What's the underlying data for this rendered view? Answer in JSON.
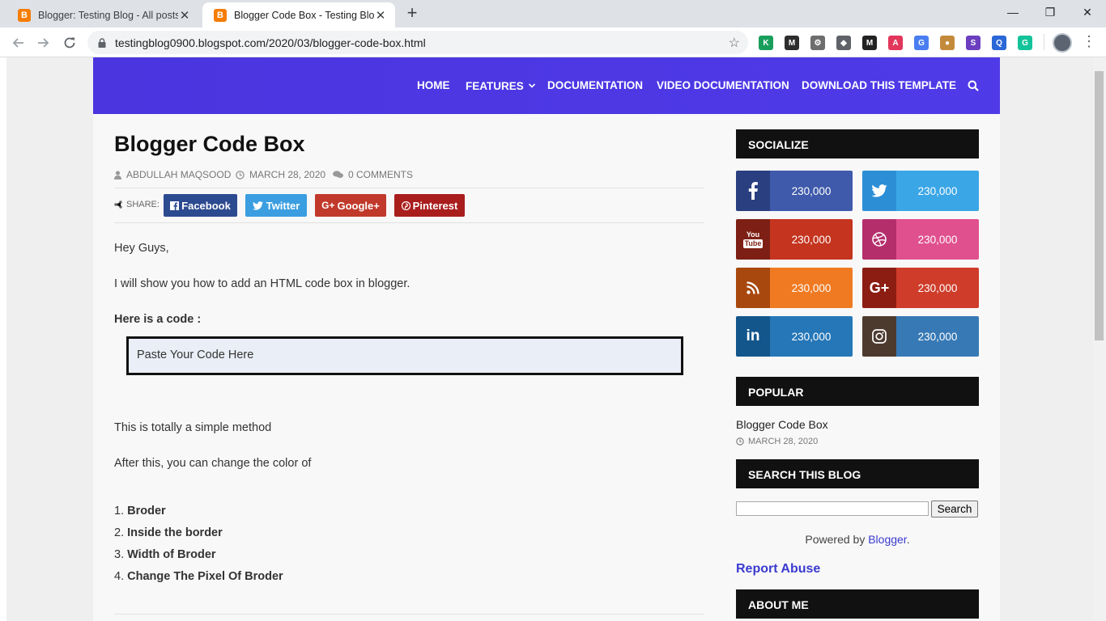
{
  "browser": {
    "tabs": [
      {
        "title": "Blogger: Testing Blog - All posts",
        "favicon": "B"
      },
      {
        "title": "Blogger Code Box - Testing Blog",
        "favicon": "B"
      }
    ],
    "new_tab_label": "+",
    "url": "testingblog0900.blogspot.com/2020/03/blogger-code-box.html",
    "extensions": [
      {
        "icon": "k-extension-icon",
        "label": "K",
        "color": "#1a9e5c"
      },
      {
        "icon": "m-extension-icon",
        "label": "M",
        "color": "#2d2d2d"
      },
      {
        "icon": "gear-extension-icon",
        "label": "⚙",
        "color": "#6d6d6d"
      },
      {
        "icon": "fox-extension-icon",
        "label": "◆",
        "color": "#5f6368"
      },
      {
        "icon": "medium-extension-icon",
        "label": "M",
        "color": "#222222"
      },
      {
        "icon": "a-extension-icon",
        "label": "A",
        "color": "#e2365b"
      },
      {
        "icon": "translate-extension-icon",
        "label": "G",
        "color": "#4a7ef0"
      },
      {
        "icon": "cookie-extension-icon",
        "label": "●",
        "color": "#c48a3c"
      },
      {
        "icon": "s-extension-icon",
        "label": "S",
        "color": "#6b3fbf"
      },
      {
        "icon": "q-extension-icon",
        "label": "Q",
        "color": "#2b67d6"
      },
      {
        "icon": "grammarly-extension-icon",
        "label": "G",
        "color": "#15c39a"
      }
    ]
  },
  "nav": {
    "items": [
      "HOME",
      "FEATURES",
      "DOCUMENTATION",
      "VIDEO DOCUMENTATION",
      "DOWNLOAD THIS TEMPLATE"
    ],
    "color": "#4e34e6"
  },
  "post": {
    "title": "Blogger Code Box",
    "author": "ABDULLAH MAQSOOD",
    "date": "MARCH 28, 2020",
    "comments": "0 COMMENTS",
    "share_label": "SHARE:",
    "share_buttons": [
      {
        "label": "Facebook",
        "color": "#2c4a8f"
      },
      {
        "label": "Twitter",
        "color": "#3a9ee0"
      },
      {
        "label": "Google+",
        "color": "#c0392b"
      },
      {
        "label": "Pinterest",
        "color": "#aa1d1d"
      }
    ],
    "greeting": "Hey Guys,",
    "intro": "I will show you how to add an HTML code box in blogger.",
    "code_heading": "Here is a code :",
    "code_text": "Paste Your Code Here",
    "simple": "This is totally a simple method",
    "after": "After this, you can change the color of",
    "list": [
      "Broder",
      "Inside the border",
      "Width of Broder",
      "Change The Pixel Of Broder"
    ]
  },
  "sidebar": {
    "socialize_title": "SOCIALIZE",
    "social": [
      {
        "network": "facebook-icon",
        "count": "230,000",
        "dark": "#2a3f7f",
        "light": "#3f5aab"
      },
      {
        "network": "twitter-icon",
        "count": "230,000",
        "dark": "#2c8fd6",
        "light": "#3aa6e6"
      },
      {
        "network": "youtube-icon",
        "count": "230,000",
        "dark": "#7d1f14",
        "light": "#c4341e"
      },
      {
        "network": "dribbble-icon",
        "count": "230,000",
        "dark": "#b52e6c",
        "light": "#e0508e"
      },
      {
        "network": "rss-icon",
        "count": "230,000",
        "dark": "#a8480f",
        "light": "#f07a22"
      },
      {
        "network": "google-plus-icon",
        "count": "230,000",
        "dark": "#8c1d12",
        "light": "#cf3c2a"
      },
      {
        "network": "linkedin-icon",
        "count": "230,000",
        "dark": "#13568c",
        "light": "#2577b8"
      },
      {
        "network": "instagram-icon",
        "count": "230,000",
        "dark": "#4d3a2f",
        "light": "#3779b5"
      }
    ],
    "popular_title": "POPULAR",
    "popular_post": "Blogger Code Box",
    "popular_date": "MARCH 28, 2020",
    "search_title": "SEARCH THIS BLOG",
    "search_button": "Search",
    "powered_prefix": "Powered by ",
    "powered_link": "Blogger",
    "powered_suffix": ".",
    "report_abuse": "Report Abuse",
    "about_title": "ABOUT ME"
  }
}
